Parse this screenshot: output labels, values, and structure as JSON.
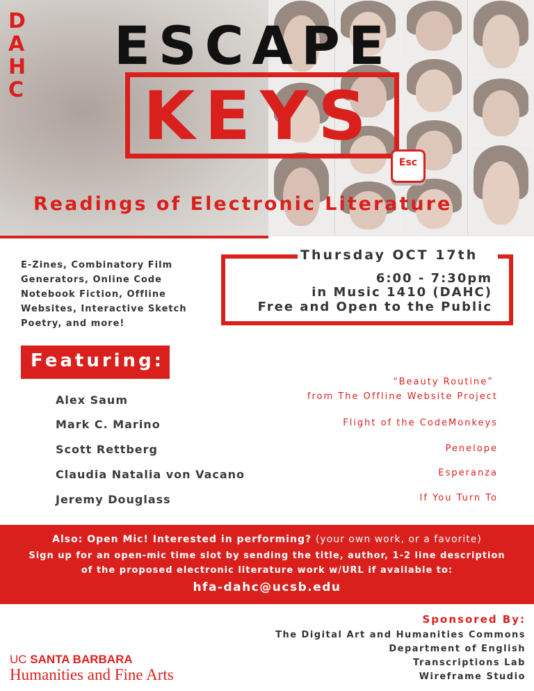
{
  "brand": {
    "dahc": "D A H C"
  },
  "title": {
    "line1": "ESCAPE",
    "line2": "KEYS",
    "esc_key": "Esc"
  },
  "subtitle": "Readings of Electronic Literature",
  "genres": "E-Zines, Combinatory Film Generators, Online Code Notebook Fiction, Offline Websites, Interactive Sketch Poetry, and more!",
  "event": {
    "day": "Thursday OCT 17th",
    "time": "6:00 - 7:30pm",
    "place": "in Music 1410 (DAHC)",
    "admission": "Free and Open to the Public"
  },
  "featuring": {
    "label": "Featuring:",
    "items": [
      {
        "author": "Alex Saum",
        "work_line1": "“Beauty Routine”",
        "work_line2": "from The Offline Website Project"
      },
      {
        "author": "Mark C. Marino",
        "work": "Flight of the CodeMonkeys"
      },
      {
        "author": "Scott Rettberg",
        "work": "Penelope"
      },
      {
        "author": "Claudia Natalia von Vacano",
        "work": "Esperanza"
      },
      {
        "author": "Jeremy Douglass",
        "work": "If You Turn To"
      }
    ]
  },
  "also": {
    "label": "Also:",
    "headline": "Open Mic! Interested in performing?",
    "aside": "(your own work, or a favorite)",
    "line2": "Sign up for an open-mic time slot by sending the title, author, 1-2 line description",
    "line3": "of the proposed electronic literature work w/URL if available to:",
    "email": "hfa-dahc@ucsb.edu"
  },
  "sponsors": {
    "label": "Sponsored By:",
    "items": [
      "The Digital Art and Humanities Commons",
      "Department of English",
      "Transcriptions Lab",
      "Wireframe Studio"
    ]
  },
  "footer": {
    "uc": "UC",
    "santa_barbara": "SANTA BARBARA",
    "division": "Humanities and Fine Arts"
  },
  "colors": {
    "accent": "#d9201d",
    "text": "#333333",
    "background": "#ffffff"
  }
}
